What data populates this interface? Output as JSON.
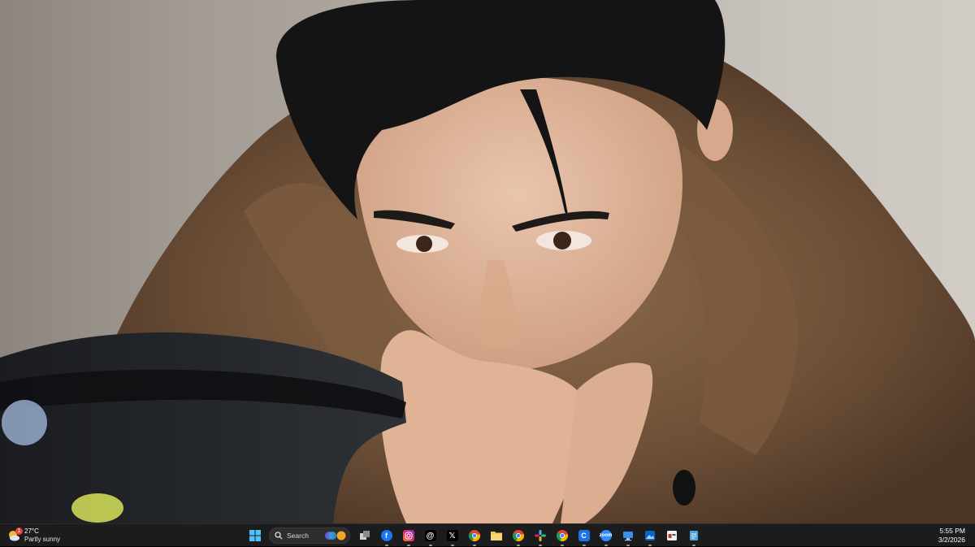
{
  "taskbar": {
    "weather": {
      "temperature": "27°C",
      "condition": "Partly sunny",
      "badge": "1",
      "icon": "partly-sunny-icon"
    },
    "search": {
      "label": "Search"
    },
    "apps": [
      {
        "name": "windows-start",
        "icon": "windows-logo-icon"
      },
      {
        "name": "search",
        "icon": "search-icon"
      },
      {
        "name": "task-view",
        "icon": "task-view-icon"
      },
      {
        "name": "facebook",
        "icon": "facebook-icon"
      },
      {
        "name": "instagram",
        "icon": "instagram-icon"
      },
      {
        "name": "threads",
        "icon": "threads-icon"
      },
      {
        "name": "x",
        "icon": "x-icon"
      },
      {
        "name": "chrome",
        "icon": "chrome-icon"
      },
      {
        "name": "file-explorer",
        "icon": "folder-icon"
      },
      {
        "name": "chrome-profile-2",
        "icon": "chrome-icon"
      },
      {
        "name": "slack",
        "icon": "slack-icon"
      },
      {
        "name": "chrome-profile-3",
        "icon": "chrome-icon"
      },
      {
        "name": "app-blue",
        "icon": "app-icon"
      },
      {
        "name": "zoom",
        "icon": "zoom-icon"
      },
      {
        "name": "remote-desktop",
        "icon": "monitor-icon"
      },
      {
        "name": "photos",
        "icon": "photos-icon"
      },
      {
        "name": "app-window",
        "icon": "window-icon"
      },
      {
        "name": "notepad",
        "icon": "notepad-icon"
      }
    ],
    "clock": {
      "time": "5:55 PM",
      "date": "3/2/2026"
    }
  },
  "colors": {
    "taskbar_bg": "#1c1c1c",
    "accent": "#0a84ff"
  }
}
